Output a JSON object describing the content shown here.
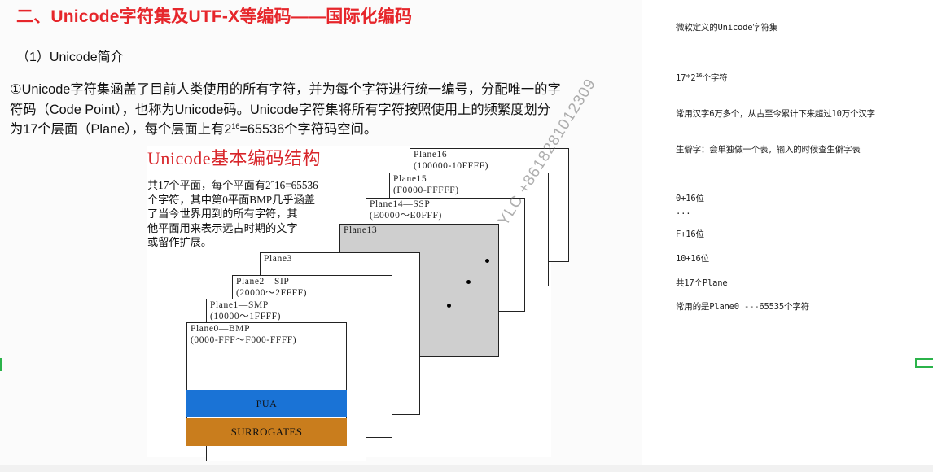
{
  "slide": {
    "title": "二、Unicode字符集及UTF-X等编码——国际化编码",
    "subtitle": "（1）Unicode简介",
    "body": {
      "line1": "①Unicode字符集涵盖了目前人类使用的所有字符，并为每个字符进行统一编号，分配唯一的字",
      "line2": "符码（Code Point），也称为Unicode码。Unicode字符集将所有字符按照使用上的频繁度划分",
      "line3_pre": "为17个层面（Plane），每个层面上有2",
      "line3_sup": "16",
      "line3_post": "=65536个字符码空间。"
    }
  },
  "diagram": {
    "title": "Unicode基本编码结构",
    "desc": [
      "    共17个平面，每个平面有2ˆ16=65536",
      "个字符，其中第0平面BMP几乎涵盖",
      "了当今世界用到的所有字符，其",
      "他平面用来表示远古时期的文字",
      "或留作扩展。"
    ],
    "planes": {
      "p16": {
        "name": "Plane16",
        "range": "(100000-10FFFF)"
      },
      "p15": {
        "name": "Plane15",
        "range": "(F0000-FFFFF)"
      },
      "p14": {
        "name": "Plane14—SSP",
        "range": "(E0000～E0FFF)"
      },
      "p13": {
        "name": "Plane13",
        "range": ""
      },
      "p3": {
        "name": "Plane3",
        "range": ""
      },
      "p2": {
        "name": "Plane2—SIP",
        "range": "(20000～2FFFF)"
      },
      "p1": {
        "name": "Plane1—SMP",
        "range": "(10000～1FFFF)"
      },
      "p0": {
        "name": "Plane0—BMP",
        "range": "(0000-FFF～F000-FFFF)"
      }
    },
    "pua_label": "PUA",
    "surrogates_label": "SURROGATES",
    "colors": {
      "title": "#d8252a",
      "pua": "#1a73d6",
      "surrogates": "#c97d1d",
      "plane13": "#cfcfcf"
    }
  },
  "watermark": "YLC +8618281012309",
  "notes": {
    "n1": "微软定义的Unicode字符集",
    "n2_pre": "17*2",
    "n2_sup": "16",
    "n2_post": "个字符",
    "n3": "常用汉字6万多个，从古至今累计下来超过10万个汉字",
    "n4": "生僻字：会单独做一个表，输入的时候查生僻字表",
    "n5": "0+16位",
    "n6": "...",
    "n7": "F+16位",
    "n8": "10+16位",
    "n9": "共17个Plane",
    "n10": "常用的是Plane0 ---65535个字符"
  },
  "colors": {
    "title_red": "#e6262b",
    "marker_green": "#2bb34a"
  }
}
